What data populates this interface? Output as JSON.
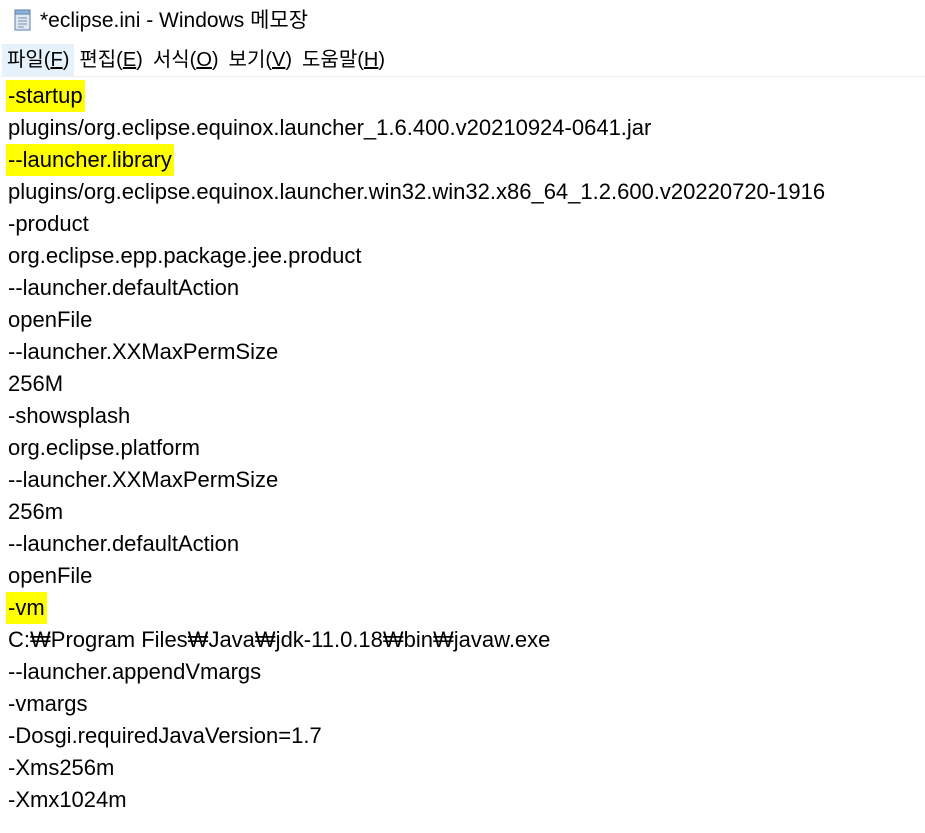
{
  "window": {
    "title": "*eclipse.ini - Windows 메모장",
    "icon": "notepad-icon"
  },
  "menu": [
    {
      "label": "파일(",
      "mnemonic": "F",
      "suffix": ")"
    },
    {
      "label": "편집(",
      "mnemonic": "E",
      "suffix": ")"
    },
    {
      "label": "서식(",
      "mnemonic": "O",
      "suffix": ")"
    },
    {
      "label": "보기(",
      "mnemonic": "V",
      "suffix": ")"
    },
    {
      "label": "도움말(",
      "mnemonic": "H",
      "suffix": ")"
    }
  ],
  "colors": {
    "highlight": "#ffff00",
    "menu_active": "#e5f1fb"
  },
  "editor": {
    "lines": [
      {
        "text": "-startup",
        "highlighted": true
      },
      {
        "text": "plugins/org.eclipse.equinox.launcher_1.6.400.v20210924-0641.jar",
        "highlighted": false
      },
      {
        "text": "--launcher.library",
        "highlighted": true
      },
      {
        "text": "plugins/org.eclipse.equinox.launcher.win32.win32.x86_64_1.2.600.v20220720-1916",
        "highlighted": false
      },
      {
        "text": "-product",
        "highlighted": false
      },
      {
        "text": "org.eclipse.epp.package.jee.product",
        "highlighted": false
      },
      {
        "text": "--launcher.defaultAction",
        "highlighted": false
      },
      {
        "text": "openFile",
        "highlighted": false
      },
      {
        "text": "--launcher.XXMaxPermSize",
        "highlighted": false
      },
      {
        "text": "256M",
        "highlighted": false
      },
      {
        "text": "-showsplash",
        "highlighted": false
      },
      {
        "text": "org.eclipse.platform",
        "highlighted": false
      },
      {
        "text": "--launcher.XXMaxPermSize",
        "highlighted": false
      },
      {
        "text": "256m",
        "highlighted": false
      },
      {
        "text": "--launcher.defaultAction",
        "highlighted": false
      },
      {
        "text": "openFile",
        "highlighted": false
      },
      {
        "text": "-vm",
        "highlighted": true
      },
      {
        "text": "C:₩Program Files₩Java₩jdk-11.0.18₩bin₩javaw.exe",
        "highlighted": false
      },
      {
        "text": "--launcher.appendVmargs",
        "highlighted": false
      },
      {
        "text": "-vmargs",
        "highlighted": false
      },
      {
        "text": "-Dosgi.requiredJavaVersion=1.7",
        "highlighted": false
      },
      {
        "text": "-Xms256m",
        "highlighted": false
      },
      {
        "text": "-Xmx1024m",
        "highlighted": false
      }
    ]
  }
}
